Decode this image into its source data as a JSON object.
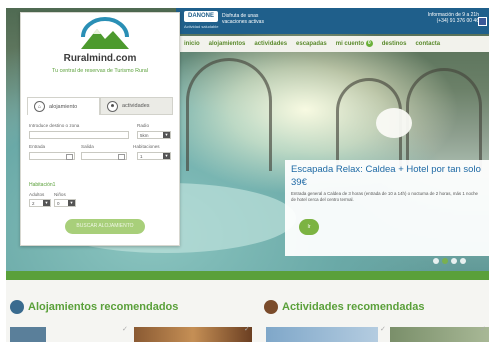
{
  "brand": {
    "name": "Ruralmind.com",
    "tagline": "Tu central de reservas de Turismo Rural"
  },
  "topbar": {
    "partner_logo": "DANONE",
    "promo_line1": "Disfruta de unas",
    "promo_line2": "vacaciones activas",
    "promo_sub": "Actividad saludable",
    "info_label": "Información",
    "info_hours": "de 9 a 21h",
    "info_phone": "(+34) 91 376 00 46"
  },
  "nav": {
    "items": [
      "inicio",
      "alojamientos",
      "actividades",
      "escapadas",
      "mi cuento",
      "destinos",
      "contacta"
    ],
    "badge": "0"
  },
  "search": {
    "tabs": [
      "alojamiento",
      "actividades"
    ],
    "destination_label": "Introduce destino o zona",
    "radius_label": "Radio",
    "radius_value": "5km",
    "checkin_label": "Entrada",
    "checkout_label": "Salida",
    "rooms_label": "Habitaciones",
    "rooms_value": "1",
    "room_section": "Habitación1",
    "adults_label": "Adultos",
    "adults_value": "2",
    "children_label": "Niños",
    "children_value": "0",
    "submit_label": "BUSCAR ALOJAMIENTO"
  },
  "offer": {
    "title": "Escapada Relax: Caldea + Hotel por tan solo",
    "price": "39€",
    "description": "Entrada general a Caldea de 3 horas (entrada de 10 a 14h) o nocturna de 2 horas, más 1 noche de hotel cerca del centro termal.",
    "button": "Ir"
  },
  "sections": {
    "lodging": "Alojamientos recomendados",
    "activities": "Actividades recomendadas"
  },
  "colors": {
    "green": "#5aa03a",
    "blue": "#1f5f8b",
    "offer_blue": "#1f6aa5"
  },
  "slider": {
    "count": 4,
    "active": 1
  }
}
